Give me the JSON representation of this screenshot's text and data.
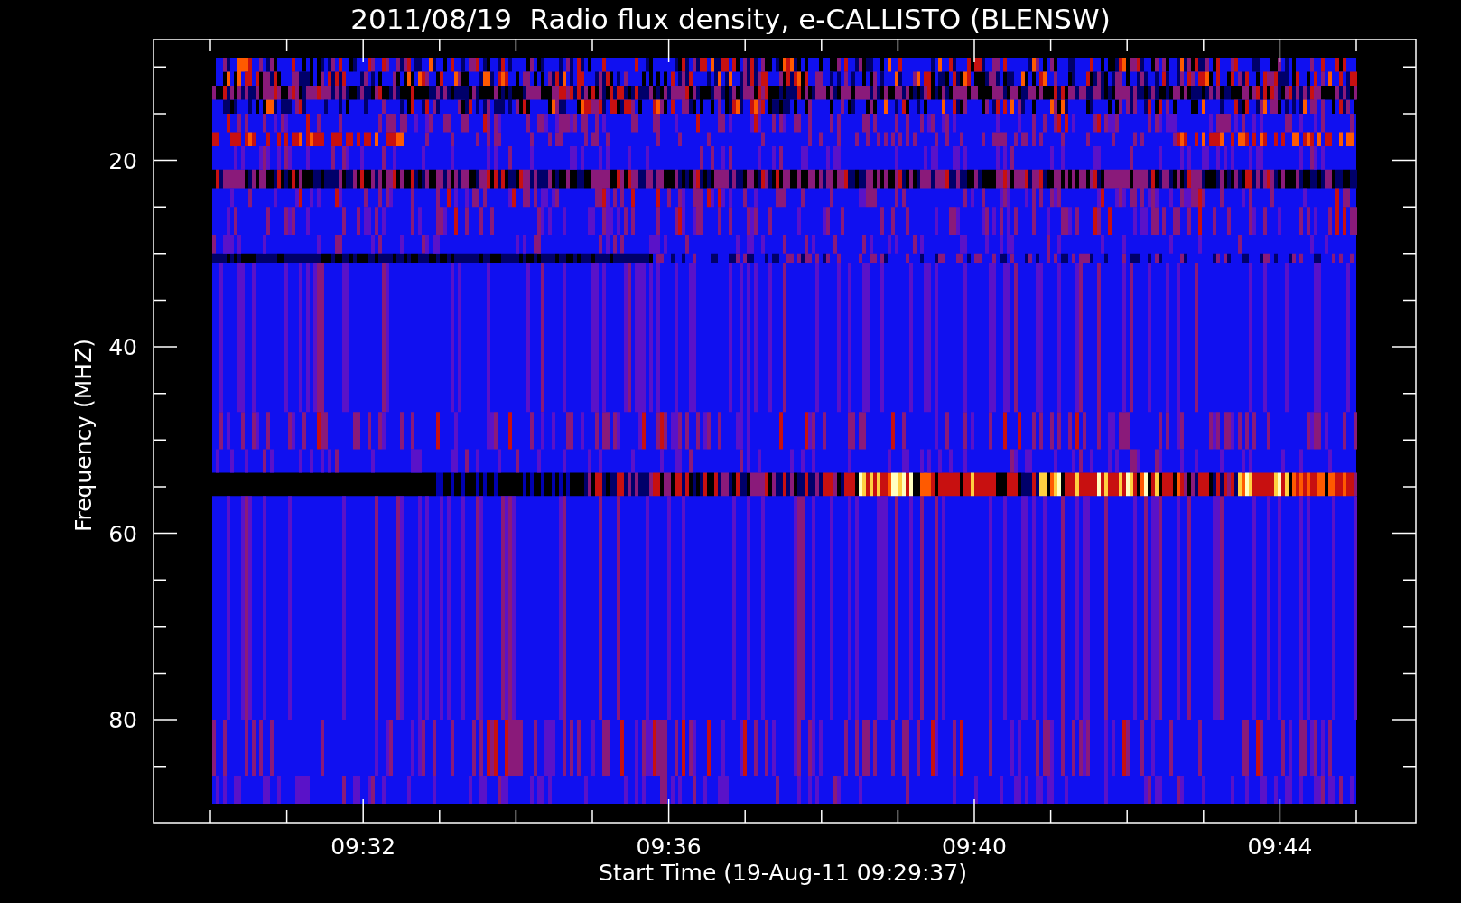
{
  "title": "2011/08/19  Radio flux density, e-CALLISTO (BLENSW)",
  "y_axis": {
    "label": "Frequency (MHZ)",
    "ticks": [
      "20",
      "40",
      "60",
      "80"
    ]
  },
  "x_axis": {
    "label": "Start Time (19-Aug-11 09:29:37)",
    "ticks": [
      "09:32",
      "09:36",
      "09:40",
      "09:44"
    ]
  }
}
